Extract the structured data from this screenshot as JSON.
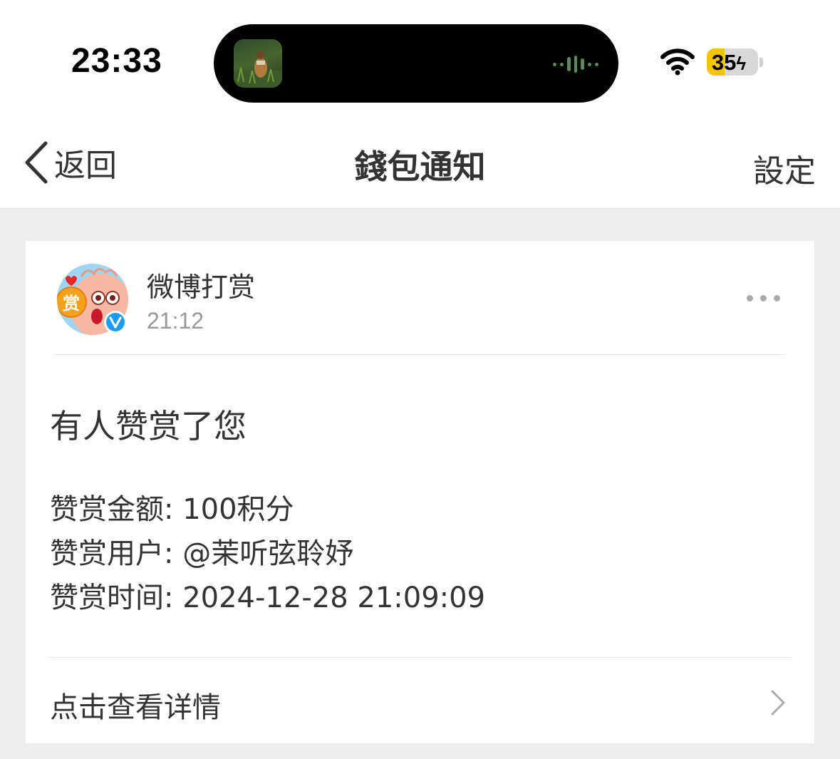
{
  "status_bar": {
    "time": "23:33",
    "battery": "35"
  },
  "nav": {
    "back_label": "返回",
    "title": "錢包通知",
    "settings_label": "設定"
  },
  "message": {
    "sender": "微博打赏",
    "time": "21:12",
    "avatar_badge": "赏",
    "headline": "有人赞赏了您",
    "details": [
      "赞赏金额: 100积分",
      "赞赏用户: @茉听弦聆妤",
      "赞赏时间: 2024-12-28 21:09:09"
    ],
    "view_details": "点击查看详情"
  },
  "colors": {
    "background": "#ededed",
    "card": "#ffffff",
    "verified_badge": "#1d9bf0",
    "battery_fill": "#f2c500"
  },
  "icons": [
    "back-chevron-icon",
    "more-icon",
    "chevron-right-icon",
    "wifi-icon",
    "verified-icon",
    "battery-icon"
  ]
}
